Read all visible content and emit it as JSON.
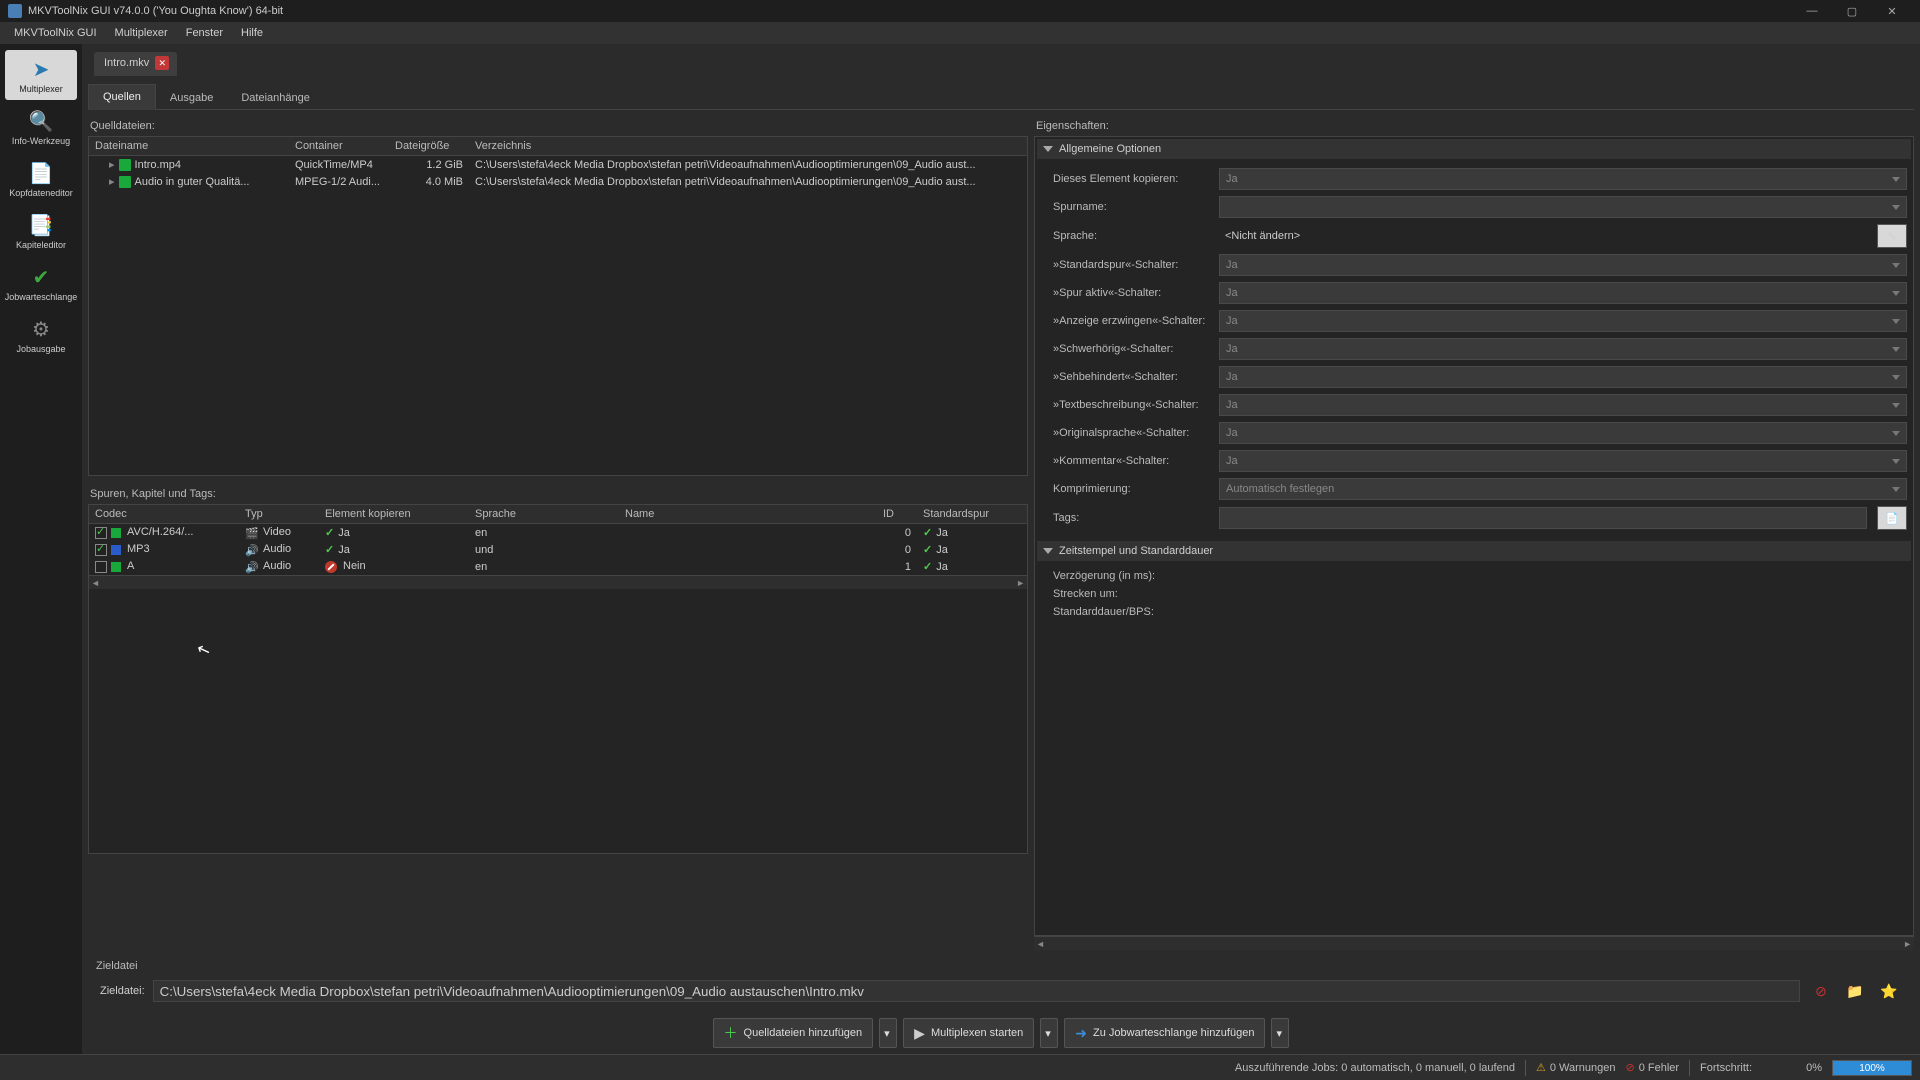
{
  "title": "MKVToolNix GUI v74.0.0 ('You Oughta Know') 64-bit",
  "menu": {
    "i0": "MKVToolNix GUI",
    "i1": "Multiplexer",
    "i2": "Fenster",
    "i3": "Hilfe"
  },
  "sidebar": {
    "multiplexer": "Multiplexer",
    "info": "Info-Werkzeug",
    "header": "Kopfdateneditor",
    "chapter": "Kapiteleditor",
    "queue": "Jobwarteschlange",
    "output": "Jobausgabe"
  },
  "doctab": {
    "name": "Intro.mkv"
  },
  "paneltabs": {
    "q": "Quellen",
    "a": "Ausgabe",
    "d": "Dateianhänge"
  },
  "sources": {
    "label": "Quelldateien:",
    "cols": {
      "name": "Dateiname",
      "container": "Container",
      "size": "Dateigröße",
      "dir": "Verzeichnis"
    },
    "rows": [
      {
        "name": "Intro.mp4",
        "container": "QuickTime/MP4",
        "size": "1.2 GiB",
        "dir": "C:\\Users\\stefa\\4eck Media Dropbox\\stefan petri\\Videoaufnahmen\\Audiooptimierungen\\09_Audio aust..."
      },
      {
        "name": "Audio in guter Qualitä...",
        "container": "MPEG-1/2 Audi...",
        "size": "4.0 MiB",
        "dir": "C:\\Users\\stefa\\4eck Media Dropbox\\stefan petri\\Videoaufnahmen\\Audiooptimierungen\\09_Audio aust..."
      }
    ]
  },
  "tracks": {
    "label": "Spuren, Kapitel und Tags:",
    "cols": {
      "codec": "Codec",
      "type": "Typ",
      "copy": "Element kopieren",
      "lang": "Sprache",
      "name": "Name",
      "id": "ID",
      "std": "Standardspur"
    },
    "rows": [
      {
        "check": true,
        "color": "#19a83c",
        "codec": "AVC/H.264/...",
        "type": "Video",
        "copy": "Ja",
        "copyOk": true,
        "lang": "en",
        "name": "",
        "id": "0",
        "std": "Ja"
      },
      {
        "check": true,
        "color": "#2a5cc9",
        "codec": "MP3",
        "type": "Audio",
        "copy": "Ja",
        "copyOk": true,
        "lang": "und",
        "name": "",
        "id": "0",
        "std": "Ja"
      },
      {
        "check": false,
        "color": "#19a83c",
        "codec": "A",
        "type": "Audio",
        "copy": "Nein",
        "copyOk": false,
        "lang": "en",
        "name": "",
        "id": "1",
        "std": "Ja"
      }
    ]
  },
  "props": {
    "label": "Eigenschaften:",
    "general": "Allgemeine Optionen",
    "timestamp": "Zeitstempel und Standarddauer",
    "fields": {
      "copy": {
        "l": "Dieses Element kopieren:",
        "v": "Ja"
      },
      "trackname": {
        "l": "Spurname:",
        "v": ""
      },
      "language": {
        "l": "Sprache:",
        "v": "<Nicht ändern>"
      },
      "stdflag": {
        "l": "»Standardspur«-Schalter:",
        "v": "Ja"
      },
      "activeflag": {
        "l": "»Spur aktiv«-Schalter:",
        "v": "Ja"
      },
      "forced": {
        "l": "»Anzeige erzwingen«-Schalter:",
        "v": "Ja"
      },
      "hearing": {
        "l": "»Schwerhörig«-Schalter:",
        "v": "Ja"
      },
      "visual": {
        "l": "»Sehbehindert«-Schalter:",
        "v": "Ja"
      },
      "textdesc": {
        "l": "»Textbeschreibung«-Schalter:",
        "v": "Ja"
      },
      "origlang": {
        "l": "»Originalsprache«-Schalter:",
        "v": "Ja"
      },
      "comment": {
        "l": "»Kommentar«-Schalter:",
        "v": "Ja"
      },
      "compress": {
        "l": "Komprimierung:",
        "v": "Automatisch festlegen"
      },
      "tags": {
        "l": "Tags:",
        "v": ""
      },
      "delay": {
        "l": "Verzögerung (in ms):",
        "v": ""
      },
      "stretch": {
        "l": "Strecken um:",
        "v": ""
      },
      "stddur": {
        "l": "Standarddauer/BPS:",
        "v": ""
      }
    }
  },
  "dest": {
    "section": "Zieldatei",
    "label": "Zieldatei:",
    "value": "C:\\Users\\stefa\\4eck Media Dropbox\\stefan petri\\Videoaufnahmen\\Audiooptimierungen\\09_Audio austauschen\\Intro.mkv"
  },
  "actions": {
    "add": "Quelldateien hinzufügen",
    "start": "Multiplexen starten",
    "queue": "Zu Jobwarteschlange hinzufügen"
  },
  "status": {
    "jobs": "Auszuführende Jobs:  0 automatisch, 0 manuell, 0 laufend",
    "warn": "0 Warnungen",
    "err": "0 Fehler",
    "prog_l": "Fortschritt:",
    "p0": "0%",
    "p100": "100%"
  }
}
